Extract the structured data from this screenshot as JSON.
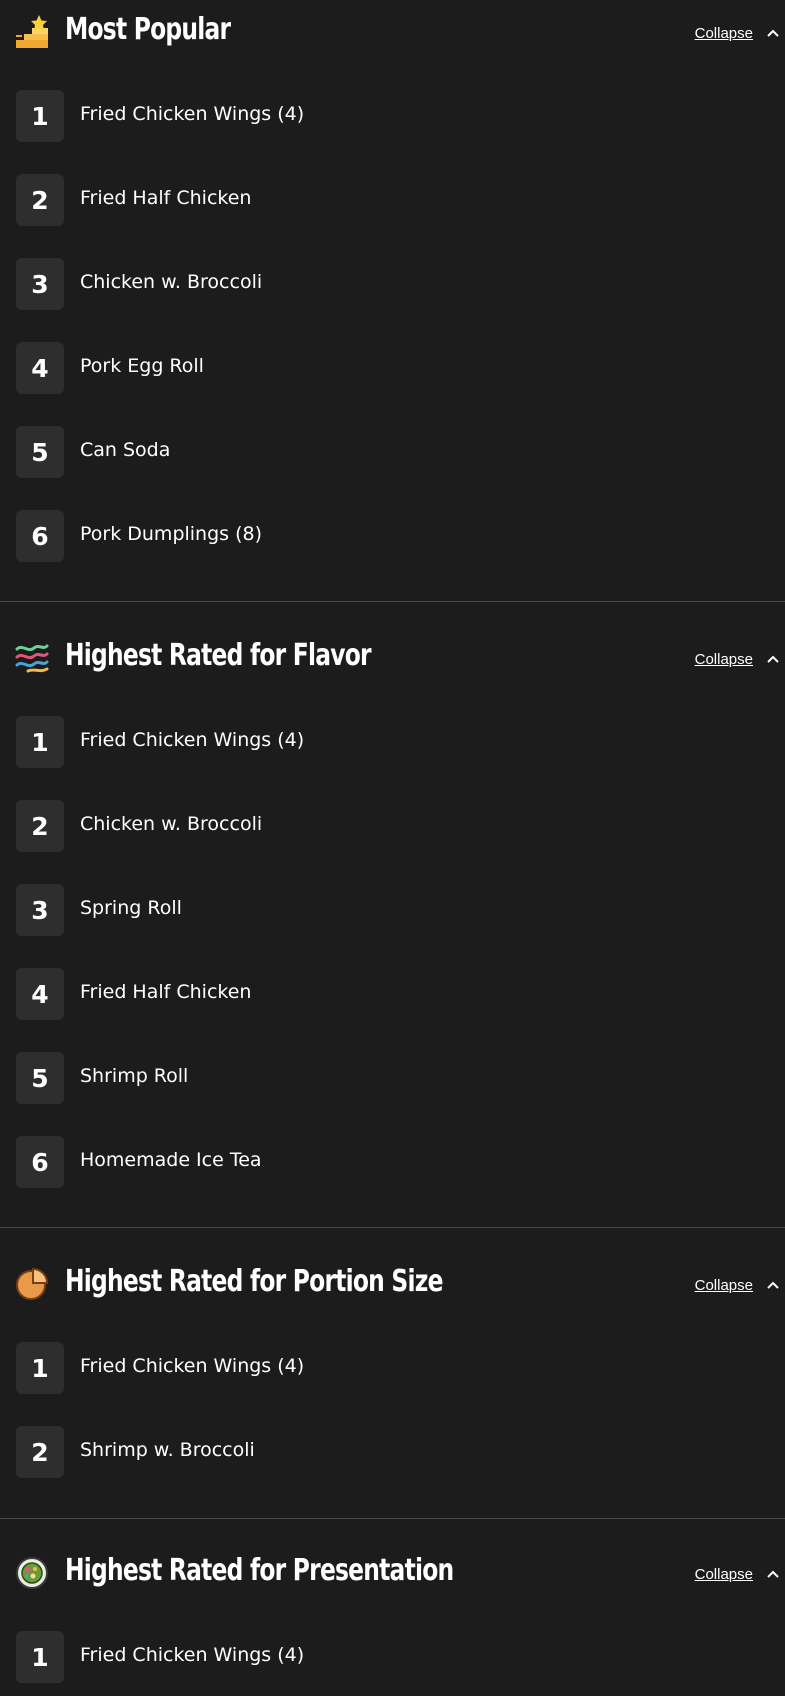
{
  "collapse_label": "Collapse",
  "sections": [
    {
      "title": "Most Popular",
      "icon": "stairs-star-icon",
      "items": [
        {
          "rank": "1",
          "name": "Fried Chicken Wings (4)"
        },
        {
          "rank": "2",
          "name": "Fried Half Chicken"
        },
        {
          "rank": "3",
          "name": "Chicken w. Broccoli"
        },
        {
          "rank": "4",
          "name": "Pork Egg Roll"
        },
        {
          "rank": "5",
          "name": "Can Soda"
        },
        {
          "rank": "6",
          "name": "Pork Dumplings (8)"
        }
      ]
    },
    {
      "title": "Highest Rated for Flavor",
      "icon": "flavor-waves-icon",
      "items": [
        {
          "rank": "1",
          "name": "Fried Chicken Wings (4)"
        },
        {
          "rank": "2",
          "name": "Chicken w. Broccoli"
        },
        {
          "rank": "3",
          "name": "Spring Roll"
        },
        {
          "rank": "4",
          "name": "Fried Half Chicken"
        },
        {
          "rank": "5",
          "name": "Shrimp Roll"
        },
        {
          "rank": "6",
          "name": "Homemade Ice Tea"
        }
      ]
    },
    {
      "title": "Highest Rated for Portion Size",
      "icon": "pie-portion-icon",
      "items": [
        {
          "rank": "1",
          "name": "Fried Chicken Wings (4)"
        },
        {
          "rank": "2",
          "name": "Shrimp w. Broccoli"
        }
      ]
    },
    {
      "title": "Highest Rated for Presentation",
      "icon": "plate-presentation-icon",
      "items": [
        {
          "rank": "1",
          "name": "Fried Chicken Wings (4)"
        }
      ]
    }
  ]
}
